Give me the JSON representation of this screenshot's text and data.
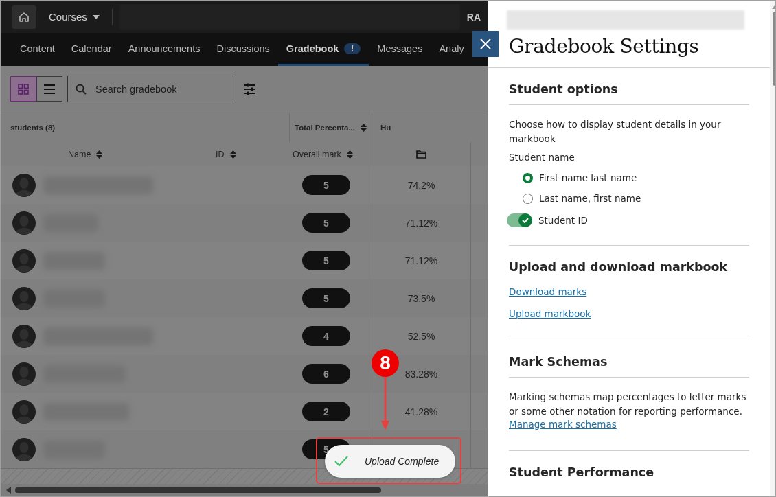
{
  "top_bar": {
    "courses_label": "Courses",
    "initials": "RA"
  },
  "nav_tabs": [
    {
      "label": "Content",
      "selected": false
    },
    {
      "label": "Calendar",
      "selected": false
    },
    {
      "label": "Announcements",
      "selected": false
    },
    {
      "label": "Discussions",
      "selected": false
    },
    {
      "label": "Gradebook",
      "selected": true,
      "badge": "!"
    },
    {
      "label": "Messages",
      "selected": false
    },
    {
      "label": "Analy",
      "selected": false
    }
  ],
  "toolbar": {
    "view_modes": [
      {
        "kind": "grid",
        "selected": true
      },
      {
        "kind": "list",
        "selected": false
      }
    ],
    "search": {
      "placeholder": "Search gradebook"
    }
  },
  "table": {
    "group_label": "students (8)",
    "columns": [
      "Name",
      "ID",
      "Overall mark"
    ],
    "extra_columns": [
      "Total Percenta...",
      "Hu"
    ],
    "rows": [
      {
        "mark": "5",
        "percent": "74.2%"
      },
      {
        "mark": "5",
        "percent": "71.12%"
      },
      {
        "mark": "5",
        "percent": "71.12%"
      },
      {
        "mark": "5",
        "percent": "73.5%"
      },
      {
        "mark": "4",
        "percent": "52.5%"
      },
      {
        "mark": "6",
        "percent": "83.28%"
      },
      {
        "mark": "2",
        "percent": "41.28%"
      },
      {
        "mark": "5"
      }
    ]
  },
  "toast": {
    "message": "Upload Complete"
  },
  "annotation": {
    "number": "8"
  },
  "settings_panel": {
    "title": "Gradebook Settings",
    "sections": [
      {
        "heading": "Student options",
        "rule_below_heading": true,
        "items": [
          {
            "kind": "text",
            "text": "Choose how to display student details in your markbook"
          },
          {
            "kind": "label",
            "text": "Student name"
          },
          {
            "kind": "radio",
            "label": "First name last name",
            "selected": true
          },
          {
            "kind": "radio",
            "label": "Last name, first name",
            "selected": false
          },
          {
            "kind": "toggle",
            "label": "Student ID",
            "on": true
          }
        ]
      },
      {
        "heading": "Upload and download markbook",
        "rule_below_heading": false,
        "items": [
          {
            "kind": "link",
            "text": "Download marks"
          },
          {
            "kind": "link",
            "text": "Upload markbook"
          }
        ]
      },
      {
        "heading": "Mark Schemas",
        "rule_below_heading": true,
        "items": [
          {
            "kind": "text",
            "text": "Marking schemas map percentages to letter marks or some other notation for reporting performance."
          },
          {
            "kind": "link",
            "text": "Manage mark schemas"
          }
        ]
      },
      {
        "heading": "Student Performance",
        "rule_below_heading": false
      }
    ]
  }
}
